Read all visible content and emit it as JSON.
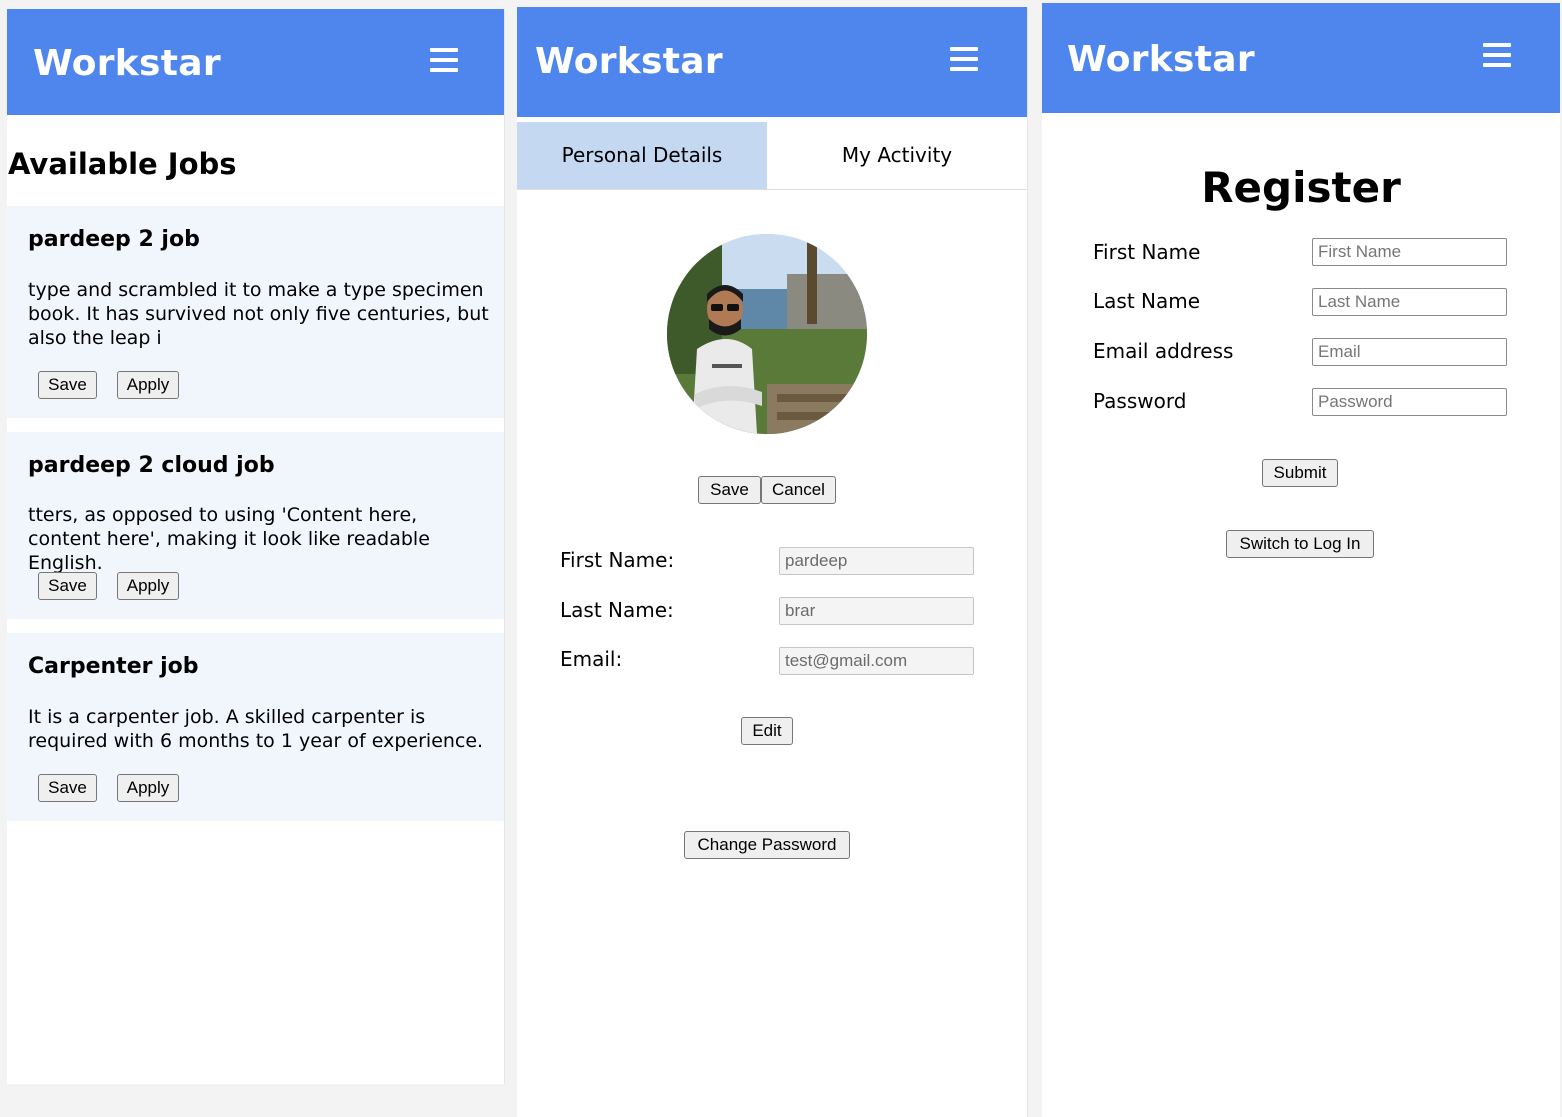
{
  "app": {
    "brand": "Workstar"
  },
  "jobs_screen": {
    "title": "Available Jobs",
    "jobs": [
      {
        "title": "pardeep 2 job",
        "description": "type and scrambled it to make a type specimen book. It has survived not only five centuries, but also the leap i",
        "save_label": "Save",
        "apply_label": "Apply"
      },
      {
        "title": "pardeep 2 cloud job",
        "description": "tters, as opposed to using 'Content here, content here', making it look like readable English.",
        "save_label": "Save",
        "apply_label": "Apply"
      },
      {
        "title": "Carpenter job",
        "description": "It is a carpenter job. A skilled carpenter is required with 6 months to 1 year of experience.",
        "save_label": "Save",
        "apply_label": "Apply"
      }
    ]
  },
  "profile_screen": {
    "tabs": [
      {
        "label": "Personal Details",
        "active": true
      },
      {
        "label": "My Activity",
        "active": false
      }
    ],
    "photo_save_label": "Save",
    "photo_cancel_label": "Cancel",
    "fields": [
      {
        "label": "First Name:",
        "value": "pardeep"
      },
      {
        "label": "Last Name:",
        "value": "brar"
      },
      {
        "label": "Email:",
        "value": "test@gmail.com"
      }
    ],
    "edit_label": "Edit",
    "change_password_label": "Change Password"
  },
  "register_screen": {
    "title": "Register",
    "fields": [
      {
        "label": "First Name",
        "placeholder": "First Name"
      },
      {
        "label": "Last Name",
        "placeholder": "Last Name"
      },
      {
        "label": "Email address",
        "placeholder": "Email"
      },
      {
        "label": "Password",
        "placeholder": "Password"
      }
    ],
    "submit_label": "Submit",
    "switch_label": "Switch to Log In"
  },
  "colors": {
    "navbar": "#4f86ed",
    "active_tab": "#c5d8f2",
    "job_card": "#f1f6fd"
  },
  "icons": {
    "menu": "hamburger-menu-icon",
    "avatar": "profile-photo"
  }
}
